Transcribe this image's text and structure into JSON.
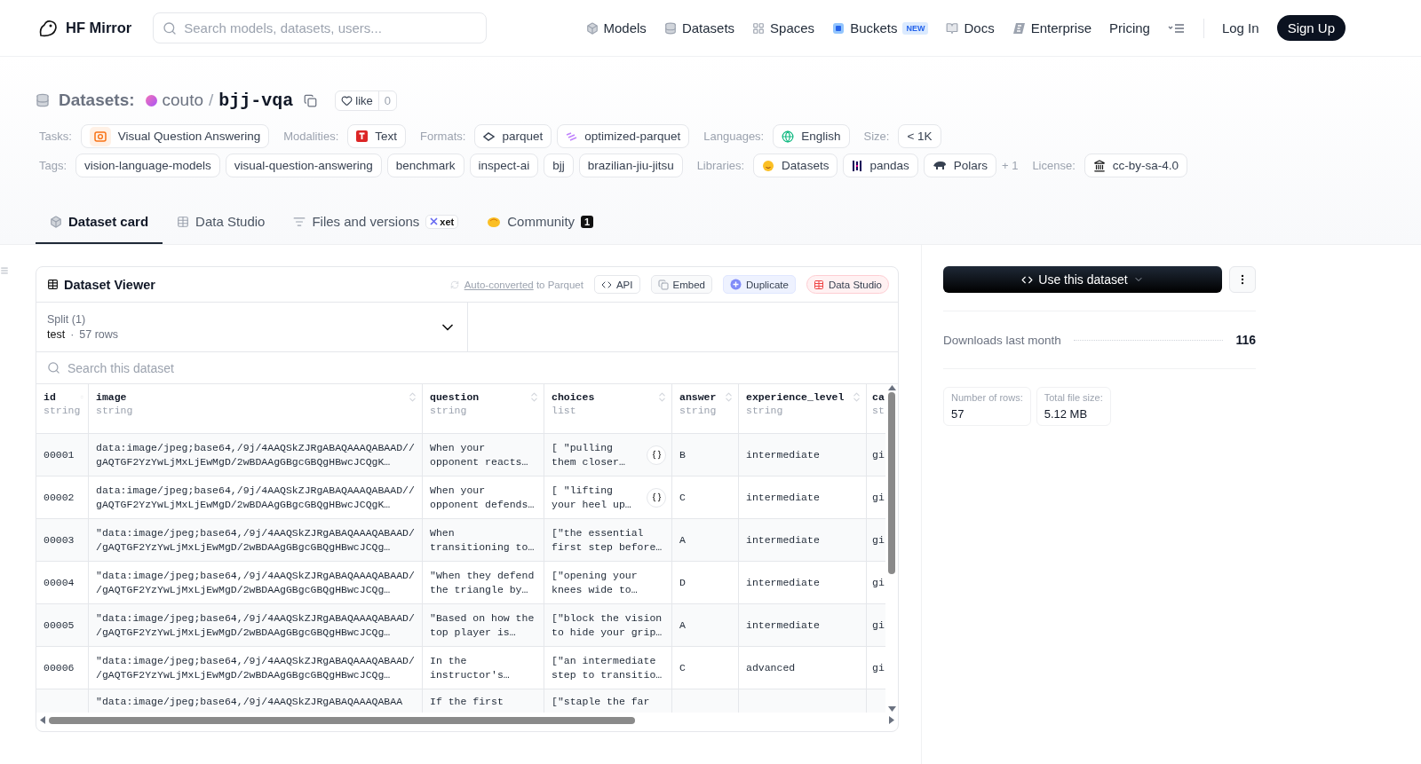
{
  "nav": {
    "brand": "HF Mirror",
    "search_placeholder": "Search models, datasets, users...",
    "items": [
      {
        "label": "Models"
      },
      {
        "label": "Datasets"
      },
      {
        "label": "Spaces"
      },
      {
        "label": "Buckets",
        "badge": "NEW"
      },
      {
        "label": "Docs"
      },
      {
        "label": "Enterprise"
      },
      {
        "label": "Pricing"
      }
    ],
    "log_in": "Log In",
    "sign_up": "Sign Up"
  },
  "header": {
    "section": "Datasets:",
    "owner": "couto",
    "separator": "/",
    "name": "bjj-vqa",
    "like": "like",
    "like_count": "0",
    "meta_rows": [
      [
        {
          "label": "Tasks:",
          "chips": [
            "Visual Question Answering"
          ]
        },
        {
          "label": "Modalities:",
          "chips": [
            "Text"
          ]
        },
        {
          "label": "Formats:",
          "chips": [
            "parquet",
            "optimized-parquet"
          ]
        },
        {
          "label": "Languages:",
          "chips": [
            "English"
          ]
        },
        {
          "label": "Size:",
          "chips": [
            "< 1K"
          ]
        }
      ],
      [
        {
          "label": "Tags:",
          "chips": [
            "vision-language-models",
            "visual-question-answering",
            "benchmark",
            "inspect-ai",
            "bjj",
            "brazilian-jiu-jitsu"
          ]
        },
        {
          "label": "Libraries:",
          "chips": [
            "Datasets",
            "pandas",
            "Polars"
          ],
          "more": "+ 1"
        },
        {
          "label": "License:",
          "chips": [
            "cc-by-sa-4.0"
          ]
        }
      ]
    ]
  },
  "tabs": [
    {
      "label": "Dataset card",
      "selected": true
    },
    {
      "label": "Data Studio",
      "selected": false
    },
    {
      "label": "Files and versions",
      "selected": false,
      "badge": "xet"
    },
    {
      "label": "Community",
      "selected": false,
      "count": "1"
    }
  ],
  "viewer": {
    "title": "Dataset Viewer",
    "converted_link": "Auto-converted",
    "converted_rest": " to Parquet",
    "buttons": [
      {
        "label": "API",
        "kind": "api"
      },
      {
        "label": "Embed",
        "kind": "embed"
      },
      {
        "label": "Duplicate",
        "kind": "duplicate"
      },
      {
        "label": "Data Studio",
        "kind": "studio"
      }
    ],
    "split": {
      "label": "Split (1)",
      "value": "test",
      "dot": "·",
      "rows": "57 rows"
    },
    "search_placeholder": "Search this dataset",
    "columns": [
      {
        "name": "id",
        "type": "string"
      },
      {
        "name": "image",
        "type": "string"
      },
      {
        "name": "question",
        "type": "string"
      },
      {
        "name": "choices",
        "type": "list"
      },
      {
        "name": "answer",
        "type": "string"
      },
      {
        "name": "experience_level",
        "type": "string"
      },
      {
        "name": "ca",
        "type": "st"
      }
    ],
    "rows": [
      {
        "cells": [
          "00001",
          "data:image/jpeg;base64,/9j/4AAQSkZJRgABAQAAAQABAAD//gAQTGF2YzYwLjMxLjEwMgD/2wBDAAgGBgcGBQgHBwcJCQgK…",
          "When your opponent reacts…",
          "[ \"pulling them closer…",
          "B",
          "intermediate",
          "gi"
        ],
        "expandable": true
      },
      {
        "cells": [
          "00002",
          "data:image/jpeg;base64,/9j/4AAQSkZJRgABAQAAAQABAAD//gAQTGF2YzYwLjMxLjEwMgD/2wBDAAgGBgcGBQgHBwcJCQgK…",
          "When your opponent defends…",
          "[ \"lifting your heel up…",
          "C",
          "intermediate",
          "gi"
        ],
        "expandable": true
      },
      {
        "cells": [
          "00003",
          "\"data:image/jpeg;base64,/9j/4AAQSkZJRgABAQAAAQABAAD//gAQTGF2YzYwLjMxLjEwMgD/2wBDAAgGBgcGBQgHBwcJCQg…",
          "When transitioning to…",
          "[\"the essential first step before…",
          "A",
          "intermediate",
          "gi"
        ],
        "expandable": false
      },
      {
        "cells": [
          "00004",
          "\"data:image/jpeg;base64,/9j/4AAQSkZJRgABAQAAAQABAAD//gAQTGF2YzYwLjMxLjEwMgD/2wBDAAgGBgcGBQgHBwcJCQg…",
          "\"When they defend the triangle by…",
          "[\"opening your knees wide to…",
          "D",
          "intermediate",
          "gi"
        ],
        "expandable": false
      },
      {
        "cells": [
          "00005",
          "\"data:image/jpeg;base64,/9j/4AAQSkZJRgABAQAAAQABAAD//gAQTGF2YzYwLjMxLjEwMgD/2wBDAAgGBgcGBQgHBwcJCQg…",
          "\"Based on how the top player is…",
          "[\"block the vision to hide your grip…",
          "A",
          "intermediate",
          "gi"
        ],
        "expandable": false
      },
      {
        "cells": [
          "00006",
          "\"data:image/jpeg;base64,/9j/4AAQSkZJRgABAQAAAQABAAD//gAQTGF2YzYwLjMxLjEwMgD/2wBDAAgGBgcGBQgHBwcJCQg…",
          "In the instructor's…",
          "[\"an intermediate step to transitio…",
          "C",
          "advanced",
          "gi"
        ],
        "expandable": false
      },
      {
        "cells": [
          "",
          "\"data:image/jpeg;base64,/9j/4AAQSkZJRgABAQAAAQABAA",
          "If the first",
          "[\"staple the far",
          "",
          "",
          ""
        ],
        "expandable": false
      }
    ]
  },
  "sidebar": {
    "use_button": "Use this dataset",
    "downloads_label": "Downloads last month",
    "downloads_value": "116",
    "stats": [
      {
        "label": "Number of rows:",
        "value": "57"
      },
      {
        "label": "Total file size:",
        "value": "5.12 MB"
      }
    ]
  }
}
